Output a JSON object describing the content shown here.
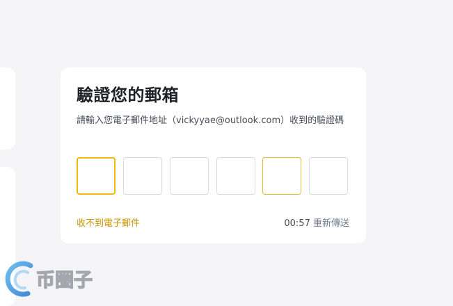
{
  "card": {
    "title": "驗證您的郵箱",
    "description": "請輸入您電子郵件地址（vickyyae@outlook.com）收到的驗證碼",
    "code_digits": [
      "",
      "",
      "",
      "",
      "",
      ""
    ],
    "no_email_link": "收不到電子郵件",
    "countdown": "00:57",
    "resend_label": "重新傳送"
  },
  "watermark": {
    "brand_text": "币圈子"
  },
  "colors": {
    "accent": "#f0b90b",
    "link": "#c99400",
    "background": "#f5f5f7"
  }
}
